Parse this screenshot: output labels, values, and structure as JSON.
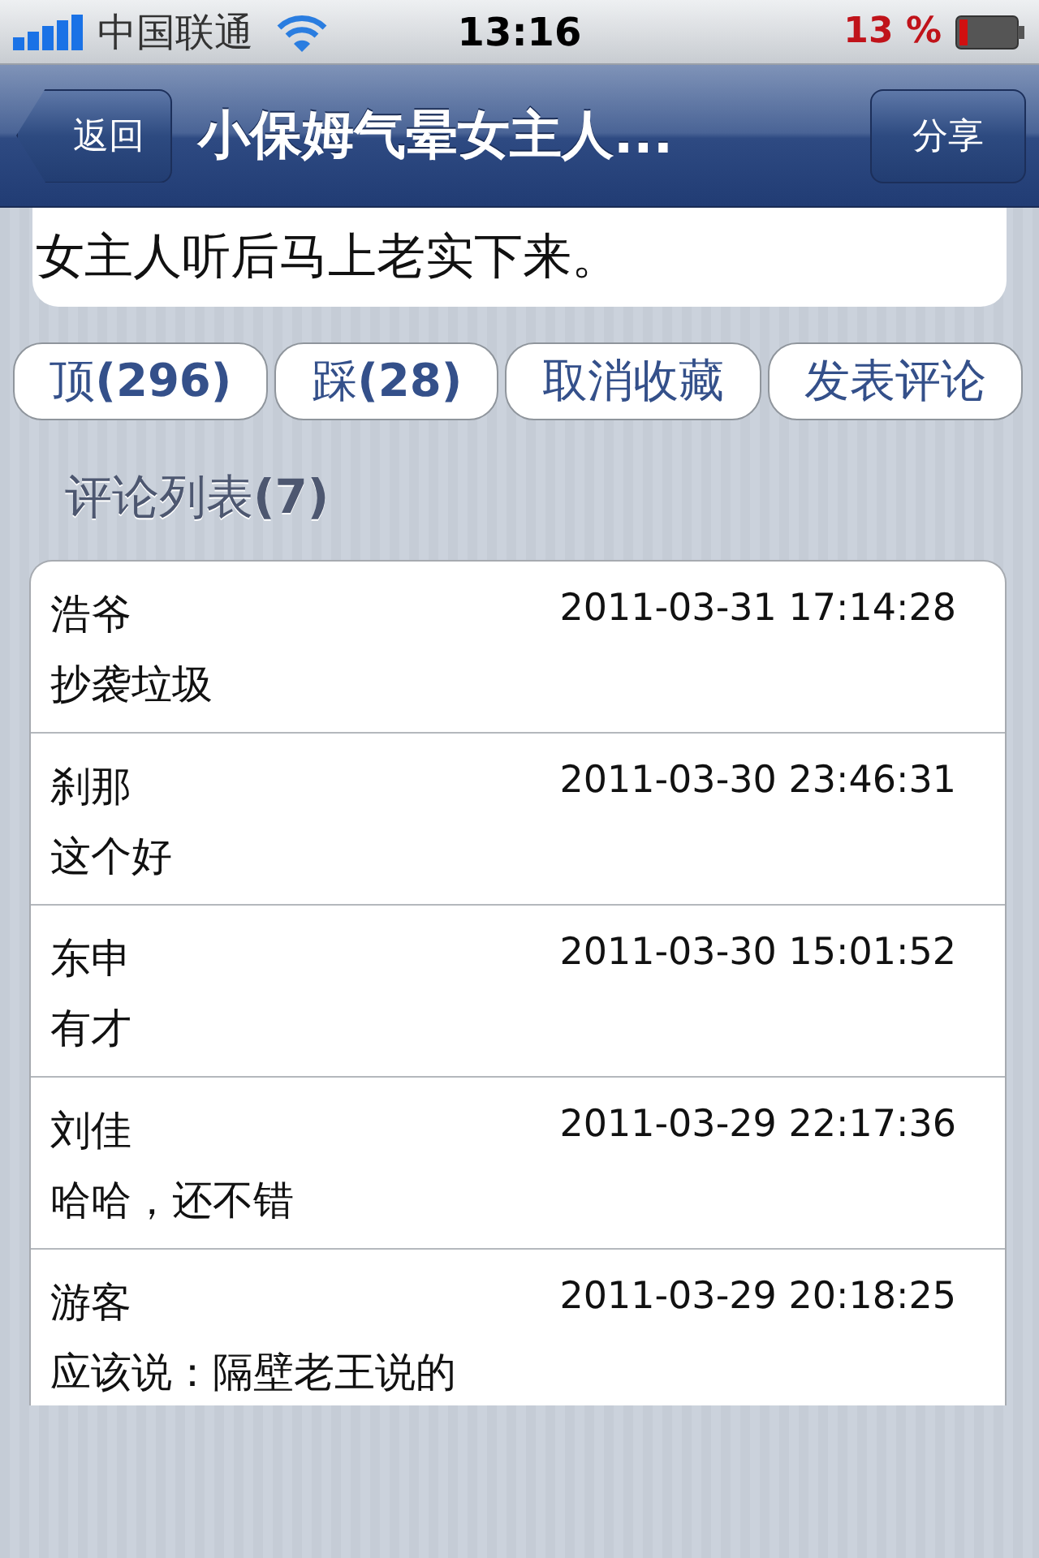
{
  "status_bar": {
    "carrier": "中国联通",
    "time": "13:16",
    "battery_text": "13 %"
  },
  "nav_bar": {
    "back": "返回",
    "title": "小保姆气晕女主人...",
    "action": "分享"
  },
  "article": {
    "last_line": "女主人听后马上老实下来。"
  },
  "actions": [
    {
      "label": "顶",
      "count": "(296)"
    },
    {
      "label": "踩",
      "count": "(28)"
    },
    {
      "label": "取消收藏"
    },
    {
      "label": "发表评论"
    }
  ],
  "comments_header": {
    "label": "评论列表",
    "count": "(7)"
  },
  "comments": [
    {
      "author": "浩爷",
      "time": "2011-03-31 17:14:28",
      "text": "抄袭垃圾"
    },
    {
      "author": "刹那",
      "time": "2011-03-30 23:46:31",
      "text": "这个好"
    },
    {
      "author": "东申",
      "time": "2011-03-30 15:01:52",
      "text": "有才"
    },
    {
      "author": "刘佳",
      "time": "2011-03-29 22:17:36",
      "text": "哈哈，还不错"
    },
    {
      "author": "游客",
      "time": "2011-03-29 20:18:25",
      "text": "应该说：隔壁老王说的"
    }
  ]
}
